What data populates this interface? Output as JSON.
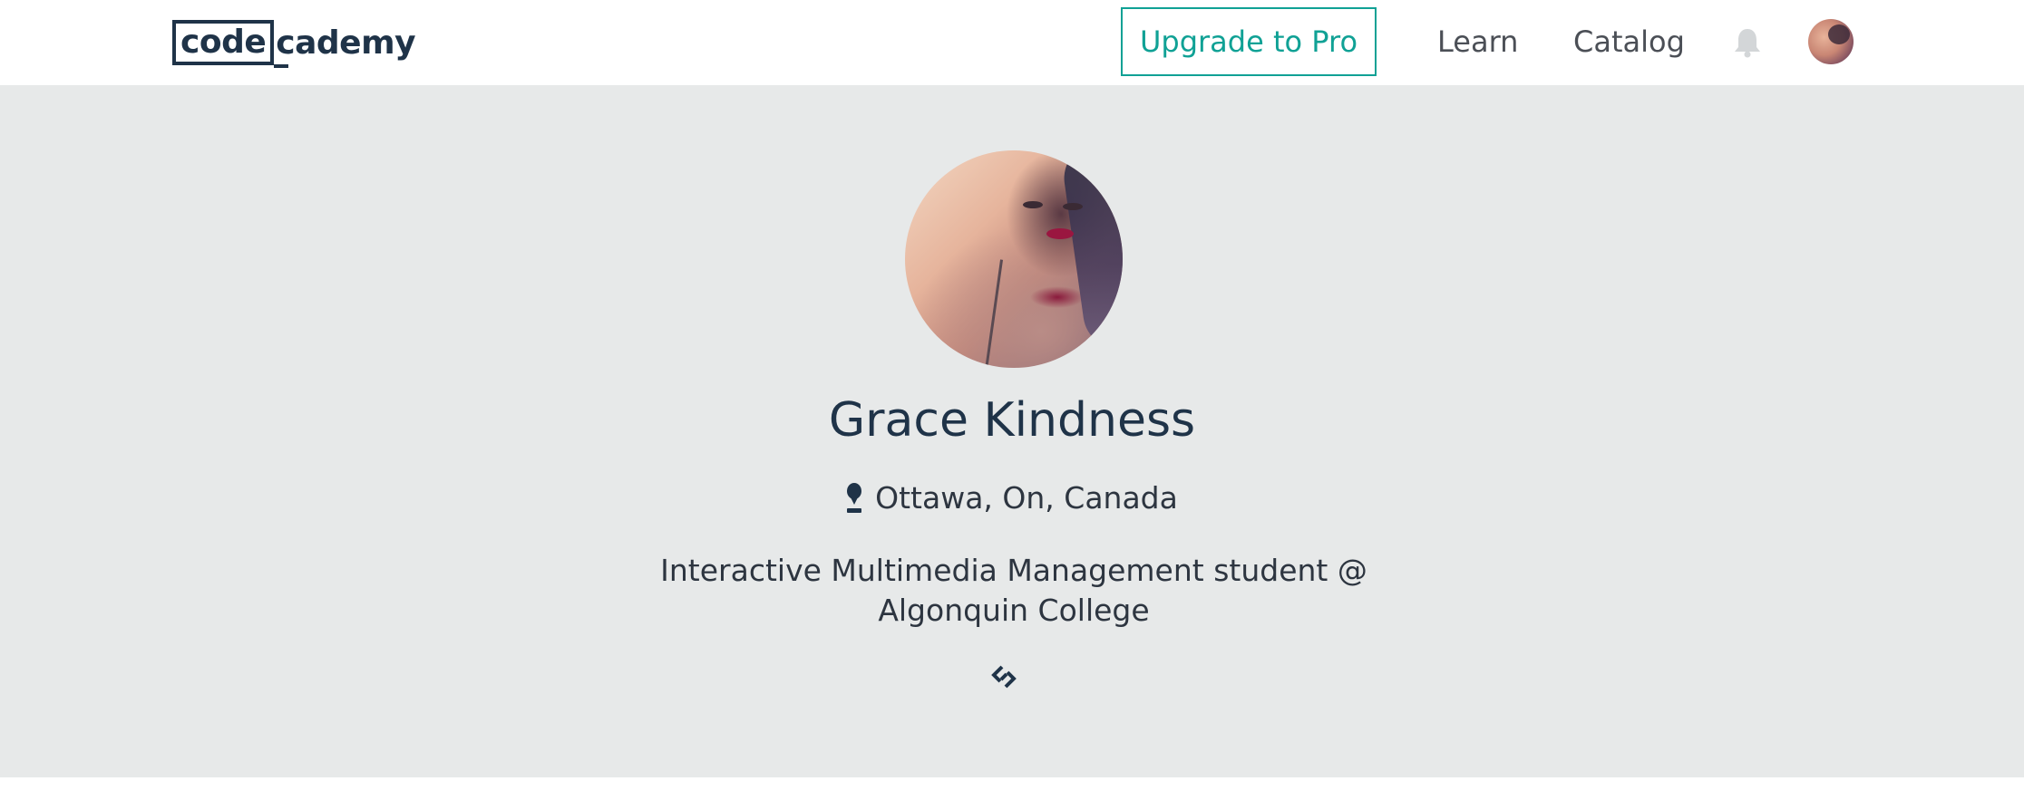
{
  "header": {
    "logo": {
      "box_text": "code",
      "rest_text": "cademy"
    },
    "upgrade_label": "Upgrade to Pro",
    "nav": {
      "learn_label": "Learn",
      "catalog_label": "Catalog"
    },
    "icons": {
      "notifications": "bell-icon",
      "account": "avatar"
    }
  },
  "profile": {
    "name": "Grace Kindness",
    "location": "Ottawa, On, Canada",
    "bio": "Interactive Multimedia Management student @ Algonquin College",
    "icons": {
      "location": "map-pin-icon",
      "website": "link-icon"
    }
  },
  "colors": {
    "brand_navy": "#1f3348",
    "accent_teal": "#10a195",
    "banner_bg": "#e7e9e9",
    "nav_text": "#4b4f56"
  }
}
